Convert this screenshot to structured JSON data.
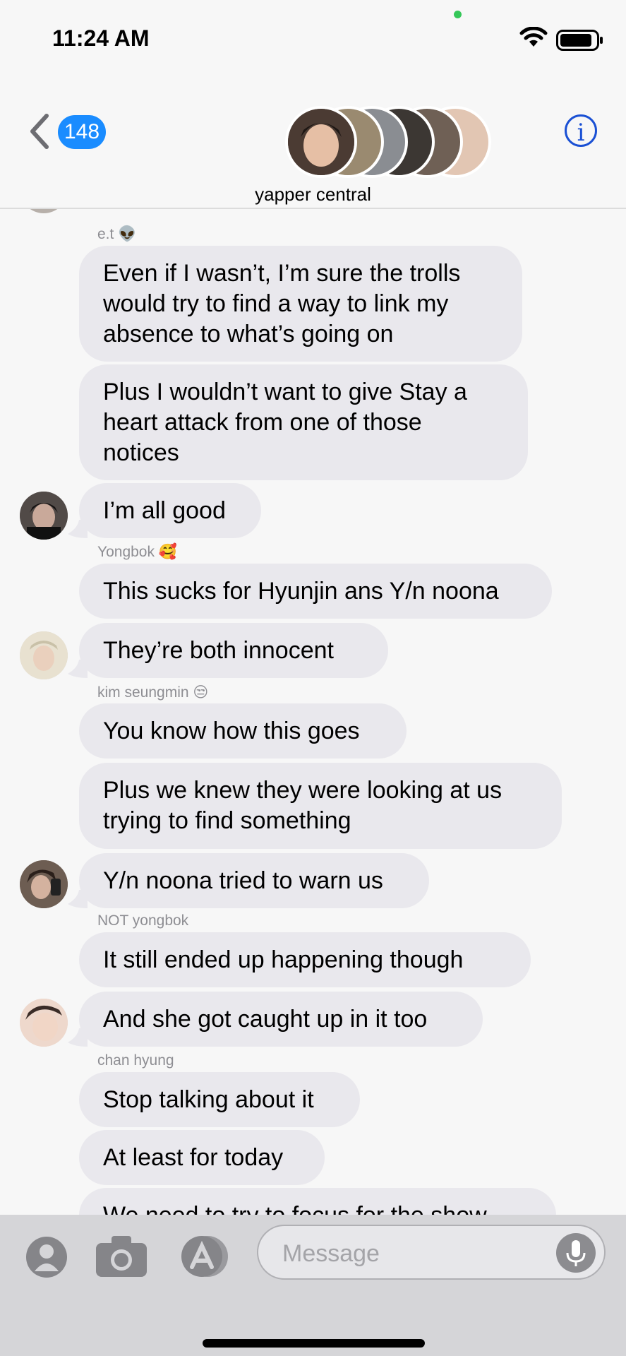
{
  "status_bar": {
    "time": "11:24 AM"
  },
  "nav": {
    "back_count": "148",
    "group_name": "yapper central",
    "info_label": "i"
  },
  "messages": [
    {
      "sender": "e.t 👽"
    },
    {
      "text": "Even if I wasn’t, I’m sure the trolls\nwould try to find a way to link my\nabsence to what’s going on"
    },
    {
      "text": "Plus I wouldn’t want to give Stay a\nheart attack from one of those\nnotices"
    },
    {
      "text": "I’m all good"
    },
    {
      "sender": "Yongbok 🥰"
    },
    {
      "text": "This sucks for Hyunjin ans Y/n noona"
    },
    {
      "text": "They’re both innocent"
    },
    {
      "sender": "kim seungmin 😒"
    },
    {
      "text": "You know how this goes"
    },
    {
      "text": "Plus we knew they were looking at us\ntrying to find something"
    },
    {
      "text": "Y/n noona tried to warn us"
    },
    {
      "sender": "NOT yongbok"
    },
    {
      "text": "It still ended up happening though"
    },
    {
      "text": "And she got caught up in it too"
    },
    {
      "sender": "chan hyung"
    },
    {
      "text": "Stop talking about it"
    },
    {
      "text": "At least for today"
    },
    {
      "text": "We need to try to focus for the show"
    }
  ],
  "input": {
    "placeholder": "Message"
  }
}
